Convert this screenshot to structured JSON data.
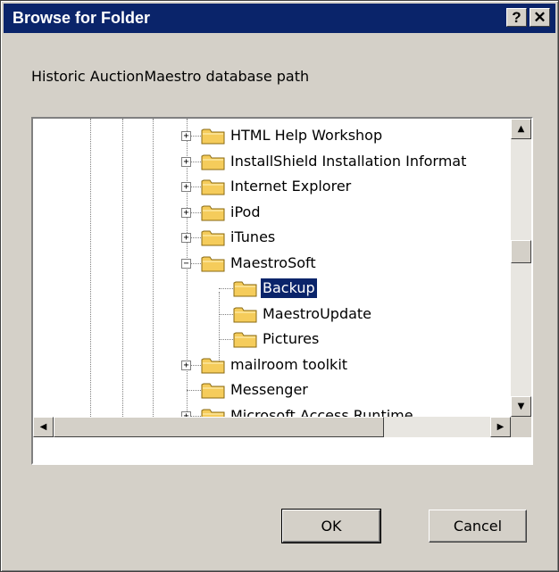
{
  "window": {
    "title": "Browse for Folder",
    "help_label": "?",
    "close_label": "✕"
  },
  "prompt": "Historic AuctionMaestro database path",
  "tree": {
    "items": [
      {
        "label": "HTML Help Workshop",
        "level": 0,
        "expander": "+",
        "selected": false
      },
      {
        "label": "InstallShield Installation Informat",
        "level": 0,
        "expander": "+",
        "selected": false
      },
      {
        "label": "Internet Explorer",
        "level": 0,
        "expander": "+",
        "selected": false
      },
      {
        "label": "iPod",
        "level": 0,
        "expander": "+",
        "selected": false
      },
      {
        "label": "iTunes",
        "level": 0,
        "expander": "+",
        "selected": false
      },
      {
        "label": "MaestroSoft",
        "level": 0,
        "expander": "−",
        "selected": false
      },
      {
        "label": "Backup",
        "level": 1,
        "expander": "",
        "selected": true
      },
      {
        "label": "MaestroUpdate",
        "level": 1,
        "expander": "",
        "selected": false
      },
      {
        "label": "Pictures",
        "level": 1,
        "expander": "",
        "selected": false
      },
      {
        "label": "mailroom toolkit",
        "level": 0,
        "expander": "+",
        "selected": false
      },
      {
        "label": "Messenger",
        "level": 0,
        "expander": "",
        "selected": false
      },
      {
        "label": "Microsoft Access Runtime",
        "level": 0,
        "expander": "+",
        "selected": false
      }
    ]
  },
  "scrollbars": {
    "up_arrow": "▲",
    "down_arrow": "▼",
    "left_arrow": "◀",
    "right_arrow": "▶"
  },
  "buttons": {
    "ok": "OK",
    "cancel": "Cancel"
  },
  "colors": {
    "titlebar": "#0a246a",
    "dialog_bg": "#d4d0c8",
    "folder": "#f5cc5b",
    "selection": "#0a246a"
  }
}
